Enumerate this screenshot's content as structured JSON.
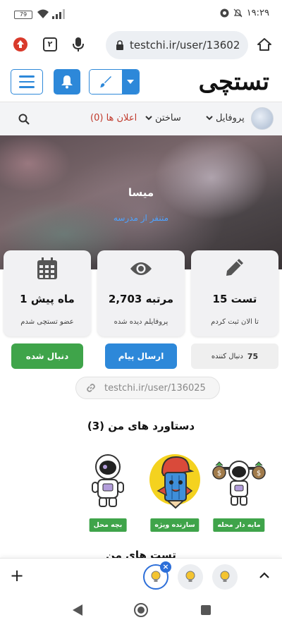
{
  "status_bar": {
    "battery": "79",
    "time": "۱۹:۲۹"
  },
  "browser": {
    "tab_count": "۲",
    "url": "testchi.ir/user/13602"
  },
  "site": {
    "logo": "تستچی"
  },
  "nav": {
    "profile": "پروفایل",
    "build": "ساختن",
    "notifications": "اعلان ها (0)"
  },
  "profile": {
    "name": "میسا",
    "tagline": "متنفر از مدرسه"
  },
  "stats": [
    {
      "icon": "pencil-icon",
      "value": "15 تست",
      "label": "تا الان ثبت کردم"
    },
    {
      "icon": "eye-icon",
      "value": "2,703 مرتبه",
      "label": "پروفایلم دیده شده"
    },
    {
      "icon": "calendar-icon",
      "value": "1 ماه پیش",
      "label": "عضو تستچی شدم"
    }
  ],
  "actions": {
    "follow": "دنبال شده",
    "message": "ارسال پیام",
    "followers_count": "75",
    "followers_label": "دنبال کننده"
  },
  "profile_link": "testchi.ir/user/136025",
  "achievements": {
    "title": "دستاورد های من (3)",
    "items": [
      {
        "label": "مایه دار محله",
        "icon": "astronaut-money-icon"
      },
      {
        "label": "سازنده ویژه",
        "icon": "pencil-mascot-icon"
      },
      {
        "label": "بچه محل",
        "icon": "astronaut-icon"
      }
    ]
  },
  "tests_title": "تست های من",
  "bottom_tabs": {
    "plus": "+",
    "badge": "×"
  },
  "colors": {
    "primary": "#2d88d9",
    "success": "#3fa44a",
    "notif_red": "#c0392b",
    "subtitle_blue": "#4ea3ff"
  }
}
